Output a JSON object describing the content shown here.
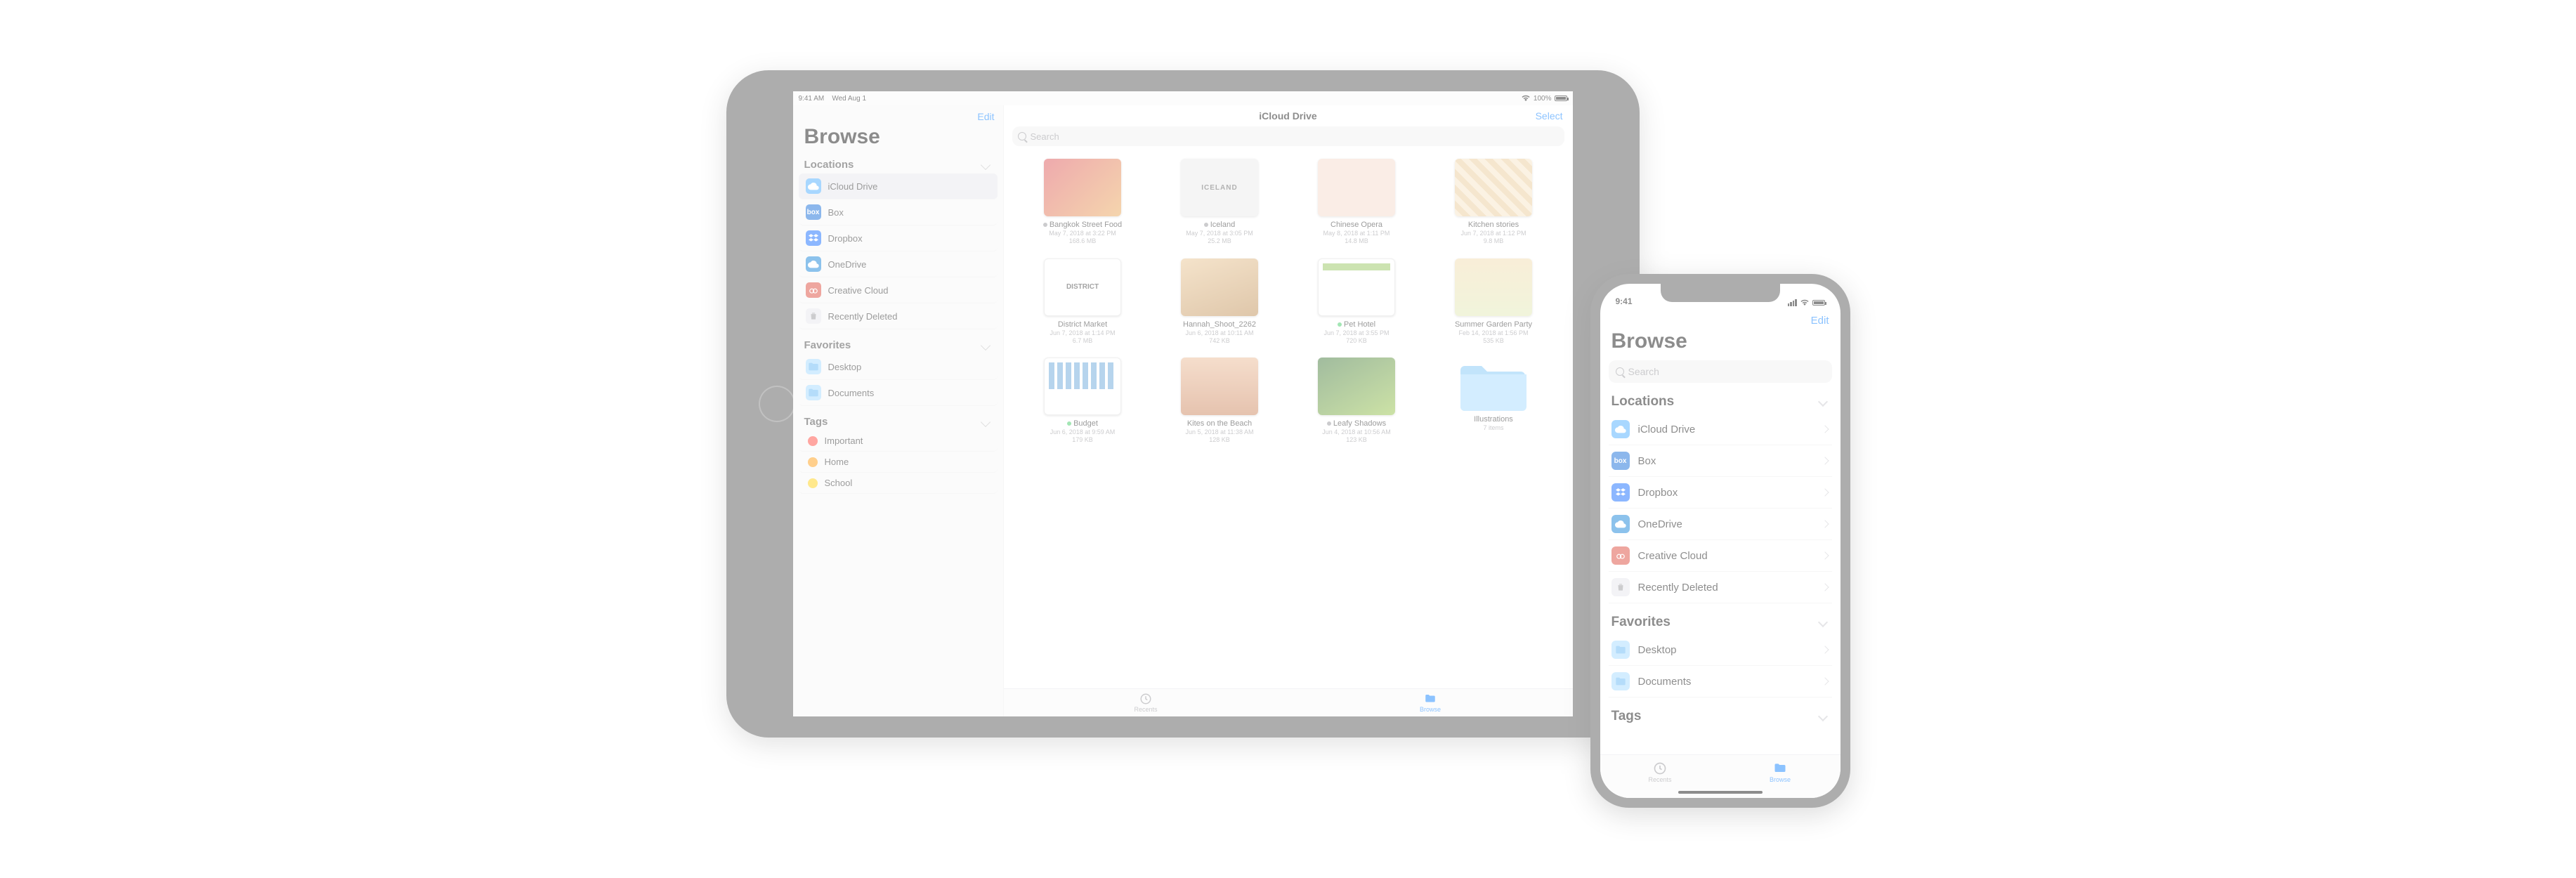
{
  "ipad": {
    "statusbar": {
      "time": "9:41 AM",
      "date": "Wed Aug 1",
      "battery": "100%"
    },
    "sidebar": {
      "edit": "Edit",
      "title": "Browse",
      "sections": {
        "locations": {
          "header": "Locations",
          "items": [
            {
              "label": "iCloud Drive",
              "icon": "icloud",
              "active": true
            },
            {
              "label": "Box",
              "icon": "box"
            },
            {
              "label": "Dropbox",
              "icon": "dropbox"
            },
            {
              "label": "OneDrive",
              "icon": "onedrive"
            },
            {
              "label": "Creative Cloud",
              "icon": "cc"
            },
            {
              "label": "Recently Deleted",
              "icon": "trash"
            }
          ]
        },
        "favorites": {
          "header": "Favorites",
          "items": [
            {
              "label": "Desktop",
              "icon": "folder"
            },
            {
              "label": "Documents",
              "icon": "folder"
            }
          ]
        },
        "tags": {
          "header": "Tags",
          "items": [
            {
              "label": "Important",
              "color": "#ff3b30"
            },
            {
              "label": "Home",
              "color": "#ff9500"
            },
            {
              "label": "School",
              "color": "#ffcc00"
            }
          ]
        }
      }
    },
    "main": {
      "title": "iCloud Drive",
      "select": "Select",
      "search_placeholder": "Search",
      "items": [
        {
          "name": "Bangkok Street Food",
          "date": "May 7, 2018 at 3:22 PM",
          "size": "168.6 MB",
          "thumb": "th-bangkok",
          "shared_color": "#8e8e93"
        },
        {
          "name": "Iceland",
          "date": "May 7, 2018 at 3:05 PM",
          "size": "25.2 MB",
          "thumb": "th-iceland",
          "shared_color": "#8e8e93"
        },
        {
          "name": "Chinese Opera",
          "date": "May 8, 2018 at 1:11 PM",
          "size": "14.8 MB",
          "thumb": "th-opera"
        },
        {
          "name": "Kitchen stories",
          "date": "Jun 7, 2018 at 1:12 PM",
          "size": "9.8 MB",
          "thumb": "th-kitchen"
        },
        {
          "name": "District Market",
          "date": "Jun 7, 2018 at 1:14 PM",
          "size": "6.7 MB",
          "thumb": "th-district"
        },
        {
          "name": "Hannah_Shoot_2262",
          "date": "Jun 6, 2018 at 10:11 AM",
          "size": "742 KB",
          "thumb": "th-hannah"
        },
        {
          "name": "Pet Hotel",
          "date": "Jun 7, 2018 at 3:55 PM",
          "size": "720 KB",
          "thumb": "th-pethotel",
          "shared_color": "#34c759"
        },
        {
          "name": "Summer Garden Party",
          "date": "Feb 14, 2018 at 1:56 PM",
          "size": "535 KB",
          "thumb": "th-garden"
        },
        {
          "name": "Budget",
          "date": "Jun 6, 2018 at 9:59 AM",
          "size": "179 KB",
          "thumb": "th-budget",
          "shared_color": "#34c759"
        },
        {
          "name": "Kites on the Beach",
          "date": "Jun 5, 2018 at 11:38 AM",
          "size": "128 KB",
          "thumb": "th-kites"
        },
        {
          "name": "Leafy Shadows",
          "date": "Jun 4, 2018 at 10:56 AM",
          "size": "123 KB",
          "thumb": "th-leafy",
          "shared_color": "#8e8e93"
        },
        {
          "name": "Illustrations",
          "date": "7 items",
          "size": "",
          "thumb": "folder"
        }
      ]
    },
    "tabbar": {
      "recents": "Recents",
      "browse": "Browse"
    }
  },
  "iphone": {
    "statusbar": {
      "time": "9:41"
    },
    "edit": "Edit",
    "title": "Browse",
    "search_placeholder": "Search",
    "locations": {
      "header": "Locations",
      "items": [
        {
          "label": "iCloud Drive",
          "icon": "icloud"
        },
        {
          "label": "Box",
          "icon": "box"
        },
        {
          "label": "Dropbox",
          "icon": "dropbox"
        },
        {
          "label": "OneDrive",
          "icon": "onedrive"
        },
        {
          "label": "Creative Cloud",
          "icon": "cc"
        },
        {
          "label": "Recently Deleted",
          "icon": "trash"
        }
      ]
    },
    "favorites": {
      "header": "Favorites",
      "items": [
        {
          "label": "Desktop",
          "icon": "folder"
        },
        {
          "label": "Documents",
          "icon": "folder"
        }
      ]
    },
    "tags": {
      "header": "Tags"
    },
    "tabbar": {
      "recents": "Recents",
      "browse": "Browse"
    }
  }
}
